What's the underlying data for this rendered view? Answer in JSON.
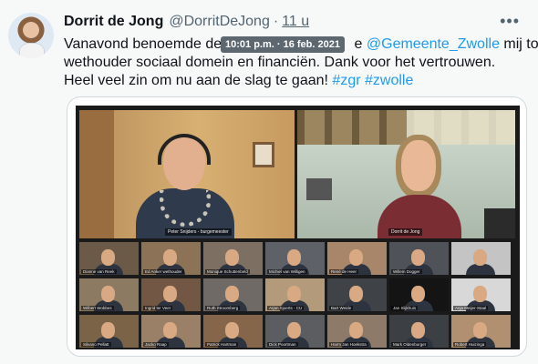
{
  "tweet": {
    "author_name": "Dorrit de Jong",
    "handle": "@DorritDeJong",
    "separator": "·",
    "time": "11 u",
    "tooltip": "10:01 p.m. · 16 feb. 2021",
    "more_icon": "ellipsis-icon",
    "text_line1_a": "Vanavond benoemde de g",
    "text_line1_b": "e ",
    "text_line1_mention": "@Gemeente_Zwolle",
    "text_line1_c": " mij tot",
    "text_line2": "wethouder sociaal domein en financiën. Dank voor het vertrouwen.",
    "text_line3_a": "Heel veel zin om nu aan de slag te gaan! ",
    "hashtag1": "#zgr",
    "hashtag2": "#zwolle",
    "link_color": "#1d9bf0"
  },
  "media": {
    "main_tiles": [
      {
        "label": "Peter Snijders - burgemeester"
      },
      {
        "label": "Dorrit de Jong"
      }
    ],
    "grid": [
      {
        "label": "Dianne van Reek",
        "bg": "#6b5a48"
      },
      {
        "label": "Ed Anker wethouder",
        "bg": "#8c7256"
      },
      {
        "label": "Monique Schuttenbeld",
        "bg": "#7d6f62"
      },
      {
        "label": "Michiel van Willigen",
        "bg": "#5e6168"
      },
      {
        "label": "René de Heer",
        "bg": "#a8866a"
      },
      {
        "label": "Willem Dogger",
        "bg": "#4f5258"
      },
      {
        "label": "",
        "bg": "#c4c4c4"
      },
      {
        "label": "Wilbert Wobbes",
        "bg": "#8d7a63"
      },
      {
        "label": "Ingrid ter Veer",
        "bg": "#725844"
      },
      {
        "label": "Ruth Stroomberg",
        "bg": "#6f6a66"
      },
      {
        "label": "Arjan Sjoerts - CU",
        "bg": "#b29a7a"
      },
      {
        "label": "Bart Weide",
        "bg": "#3f4348"
      },
      {
        "label": "Jan Slijkhuis",
        "bg": "#141414"
      },
      {
        "label": "Anja Meijer-Staal",
        "bg": "#d8d8d8"
      },
      {
        "label": "Silvano Pellatt",
        "bg": "#7b6348"
      },
      {
        "label": "Jacko Raap",
        "bg": "#9a8067"
      },
      {
        "label": "Patrick Hartman",
        "bg": "#86664a"
      },
      {
        "label": "Dick Poortman",
        "bg": "#5b5d60"
      },
      {
        "label": "Harm Jan Hoekstra",
        "bg": "#8e7a68"
      },
      {
        "label": "Mark Oldenburger",
        "bg": "#3c3f44"
      },
      {
        "label": "Robert Huizinga",
        "bg": "#b09070"
      }
    ]
  }
}
